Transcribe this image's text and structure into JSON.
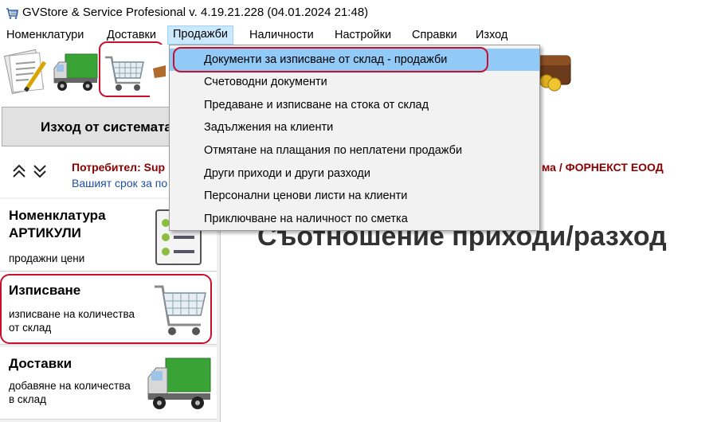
{
  "window": {
    "title": "GVStore & Service Profesional v. 4.19.21.228 (04.01.2024 21:48)"
  },
  "menubar": {
    "items": [
      {
        "label": "Номенклатури"
      },
      {
        "label": "Доставки"
      },
      {
        "label": "Продажби"
      },
      {
        "label": "Наличности"
      },
      {
        "label": "Настройки"
      },
      {
        "label": "Справки"
      },
      {
        "label": "Изход"
      }
    ],
    "active_index": 2
  },
  "dropdown": {
    "items": [
      {
        "label": "Документи за изписване от склад - продажби"
      },
      {
        "label": "Счетоводни документи"
      },
      {
        "label": "Предаване и изписване на стока от склад"
      },
      {
        "label": "Задължения на клиенти"
      },
      {
        "label": "Отмятане на плащания по неплатени продажби"
      },
      {
        "label": "Други приходи и други разходи"
      },
      {
        "label": "Персонални ценови листи на клиенти"
      },
      {
        "label": "Приключване на наличност по сметка"
      }
    ],
    "selected_index": 0
  },
  "exit_button": {
    "label": "Изход от системата"
  },
  "user_info": {
    "user": "Потребител: Sup",
    "term": "Вашият срок за по",
    "company": "ма / ФОРНЕКСТ ЕООД"
  },
  "sidebar": {
    "cards": [
      {
        "title": "Номенклатура АРТИКУЛИ",
        "title_line1": "Номенклатура",
        "title_line2": "АРТИКУЛИ",
        "subtitle": "продажни цени",
        "icon": "checklist-icon"
      },
      {
        "title": "Изписване",
        "subtitle_line1": "изписване на количества",
        "subtitle_line2": "от склад",
        "icon": "shopping-cart-icon"
      },
      {
        "title": "Доставки",
        "subtitle_line1": "добавяне на количества",
        "subtitle_line2": "в склад",
        "icon": "truck-icon"
      }
    ]
  },
  "main": {
    "heading": "Съотношение приходи/разход"
  },
  "colors": {
    "highlight_red": "#c8102e",
    "menu_selected": "#91c9f7",
    "menu_active": "#cce8ff",
    "user_text": "#8b0000",
    "term_text": "#1f4fa3"
  }
}
